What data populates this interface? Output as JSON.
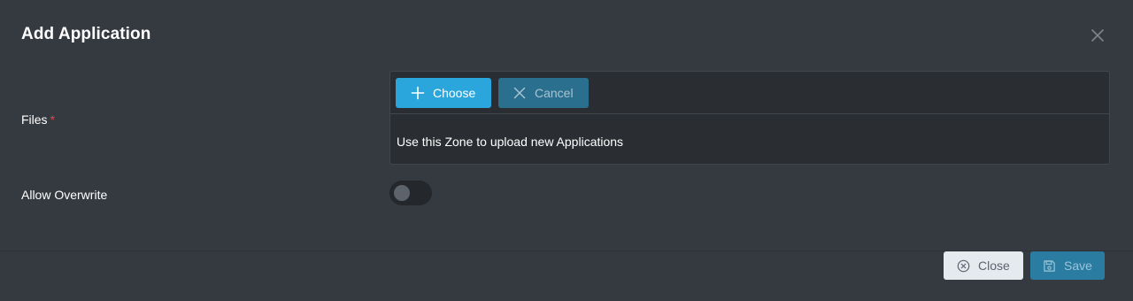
{
  "dialog": {
    "title": "Add Application",
    "close_icon": "close-icon"
  },
  "form": {
    "files": {
      "label": "Files",
      "required_marker": "*",
      "upload": {
        "choose_label": "Choose",
        "choose_icon": "plus-icon",
        "cancel_label": "Cancel",
        "cancel_icon": "x-icon",
        "empty_message": "Use this Zone to upload new Applications"
      }
    },
    "allow_overwrite": {
      "label": "Allow Overwrite",
      "checked": false
    }
  },
  "footer": {
    "close_label": "Close",
    "close_icon": "times-circle-icon",
    "save_label": "Save",
    "save_icon": "save-icon"
  },
  "colors": {
    "background": "#353a41",
    "accent": "#2ba6dd",
    "required": "#e0454f"
  }
}
